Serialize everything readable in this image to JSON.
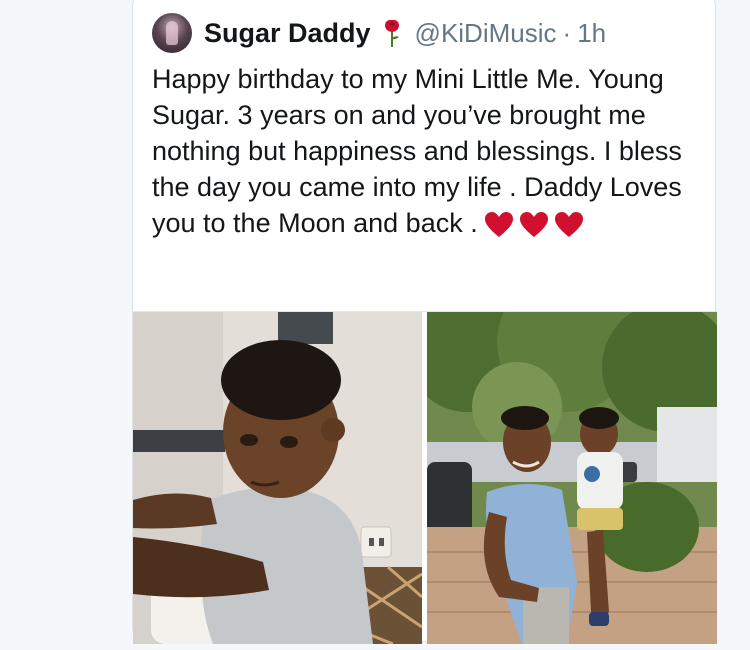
{
  "tweet": {
    "display_name": "Sugar Daddy",
    "handle": "@KiDiMusic",
    "separator": "·",
    "time": "1h",
    "text": "Happy birthday to my Mini Little Me. Young Sugar. 3 years on and you’ve brought me nothing but happiness and blessings. I bless the day you came into my life . Daddy Loves you to the Moon and back .",
    "emoji_after_name": "rose-icon",
    "trailing_emoji": [
      "heart-icon",
      "heart-icon",
      "heart-icon"
    ]
  },
  "media": {
    "count": 2,
    "items": [
      "toddler-portrait",
      "father-holding-child"
    ]
  },
  "colors": {
    "text": "#14171a",
    "secondary": "#657786",
    "heart": "#d0102e",
    "border": "#dde3e8"
  }
}
